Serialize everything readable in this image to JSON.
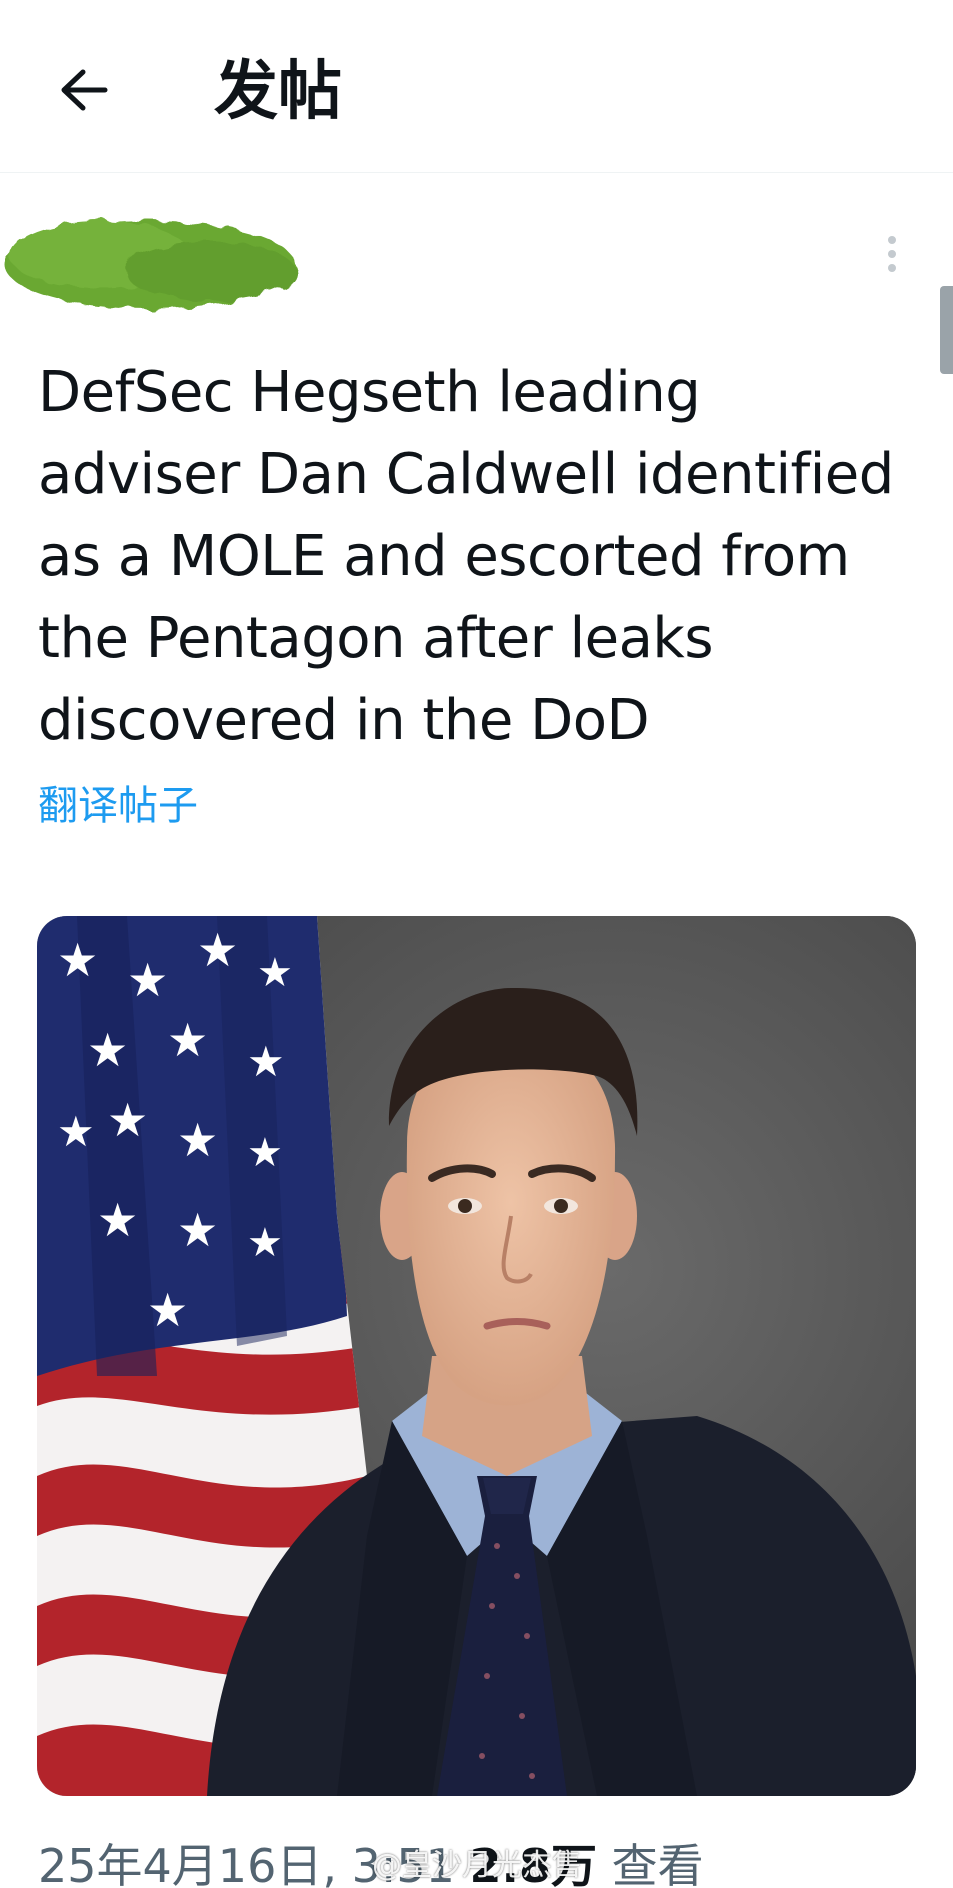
{
  "header": {
    "back_icon": "arrow-left-icon",
    "title": "发帖"
  },
  "post": {
    "author_redacted": true,
    "more_icon": "more-vertical-icon",
    "text": "DefSec Hegseth leading adviser Dan Caldwell identified as a MOLE and escorted from the Pentagon after leaks discovered in the DoD",
    "translate_label": "翻译帖子",
    "image_alt": "Portrait photo of a man in a dark suit and tie in front of a US flag",
    "meta": {
      "date": "25年4月16日",
      "time": "3:51",
      "views": "2.8万",
      "views_label": "查看"
    }
  },
  "watermark": {
    "text": "@皇沙月光杰售"
  },
  "colors": {
    "accent": "#1d9bf0",
    "text_primary": "#0f1419",
    "text_secondary": "#536471",
    "redaction_green": "#6aa832"
  }
}
